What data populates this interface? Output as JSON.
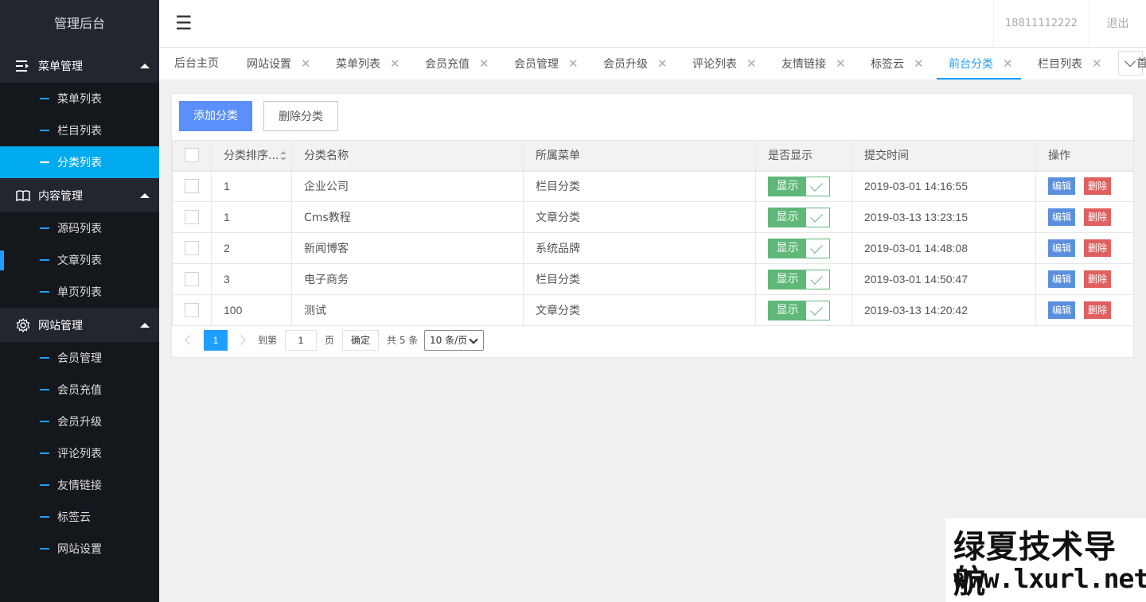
{
  "sidebar": {
    "brand": "管理后台",
    "groups": [
      {
        "label": "菜单管理",
        "icon": "menu-indent-icon",
        "items": [
          "菜单列表",
          "栏目列表",
          "分类列表"
        ]
      },
      {
        "label": "内容管理",
        "icon": "book-icon",
        "items": [
          "源码列表",
          "文章列表",
          "单页列表"
        ]
      },
      {
        "label": "网站管理",
        "icon": "gear-icon",
        "items": [
          "会员管理",
          "会员充值",
          "会员升级",
          "评论列表",
          "友情链接",
          "标签云",
          "网站设置"
        ]
      }
    ],
    "active_item": "分类列表"
  },
  "header": {
    "menu_icon": "☰",
    "user": "18811112222",
    "logout": "退出"
  },
  "tabs": {
    "items": [
      "后台主页",
      "网站设置",
      "菜单列表",
      "会员充值",
      "会员管理",
      "会员升级",
      "评论列表",
      "友情链接",
      "标签云",
      "前台分类",
      "栏目列表"
    ],
    "active": "前台分类",
    "close_glyph": "✕",
    "overflow_text": "首"
  },
  "toolbar": {
    "add_label": "添加分类",
    "delete_label": "删除分类"
  },
  "table": {
    "columns": [
      "分类排序...",
      "分类名称",
      "所属菜单",
      "是否显示",
      "提交时间",
      "操作"
    ],
    "rows": [
      {
        "order": "1",
        "name": "企业公司",
        "menu": "栏目分类",
        "show": "显示",
        "time": "2019-03-01 14:16:55"
      },
      {
        "order": "1",
        "name": "Cms教程",
        "menu": "文章分类",
        "show": "显示",
        "time": "2019-03-13 13:23:15"
      },
      {
        "order": "2",
        "name": "新闻博客",
        "menu": "系统品牌",
        "show": "显示",
        "time": "2019-03-01 14:48:08"
      },
      {
        "order": "3",
        "name": "电子商务",
        "menu": "栏目分类",
        "show": "显示",
        "time": "2019-03-01 14:50:47"
      },
      {
        "order": "100",
        "name": "测试",
        "menu": "文章分类",
        "show": "显示",
        "time": "2019-03-13 14:20:42"
      }
    ],
    "edit_label": "编辑",
    "delete_label": "删除"
  },
  "pager": {
    "current_page": "1",
    "goto_label": "到第",
    "page_input": "1",
    "page_unit": "页",
    "confirm": "确定",
    "total": "共 5 条",
    "page_size": "10 条/页"
  },
  "watermark": {
    "line1": "绿夏技术导航",
    "line2": "www.lxurl.net"
  },
  "colors": {
    "sidebar_bg": "#14171c",
    "group_bg": "#23262e",
    "accent": "#1e9fff",
    "active_item": "#00aaee",
    "show_green": "#5fb878",
    "edit_blue": "#5b8fde",
    "delete_red": "#e06060"
  }
}
